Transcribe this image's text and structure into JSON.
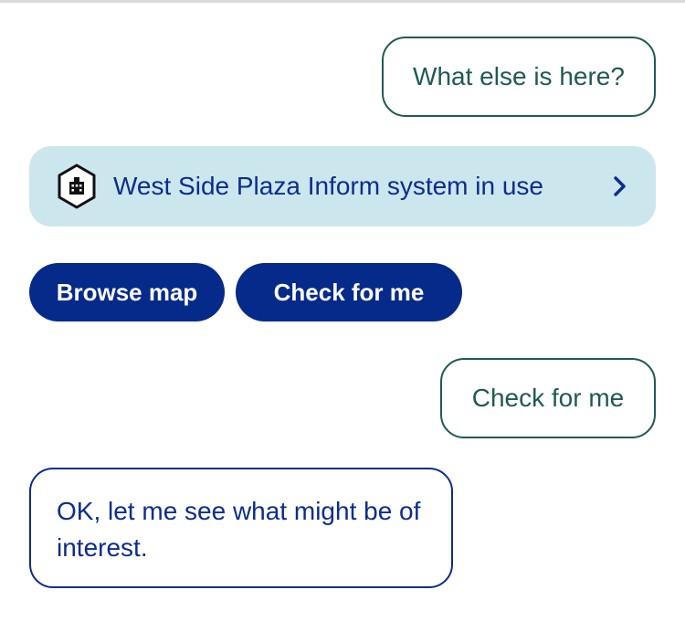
{
  "chat": {
    "user_message_1": "What else is here?",
    "location_card": {
      "label": "West Side Plaza Inform system in use",
      "icon": "building-hexagon-icon",
      "chevron": "chevron-right-icon"
    },
    "quick_replies": [
      {
        "label": "Browse map"
      },
      {
        "label": "Check for me"
      }
    ],
    "user_message_2": "Check for me",
    "bot_message": "OK, let me see what might be of interest."
  },
  "colors": {
    "user_bubble_border": "#1f5a55",
    "card_background": "#cce6ee",
    "primary": "#062a8a",
    "bot_text": "#0d2d8c"
  }
}
